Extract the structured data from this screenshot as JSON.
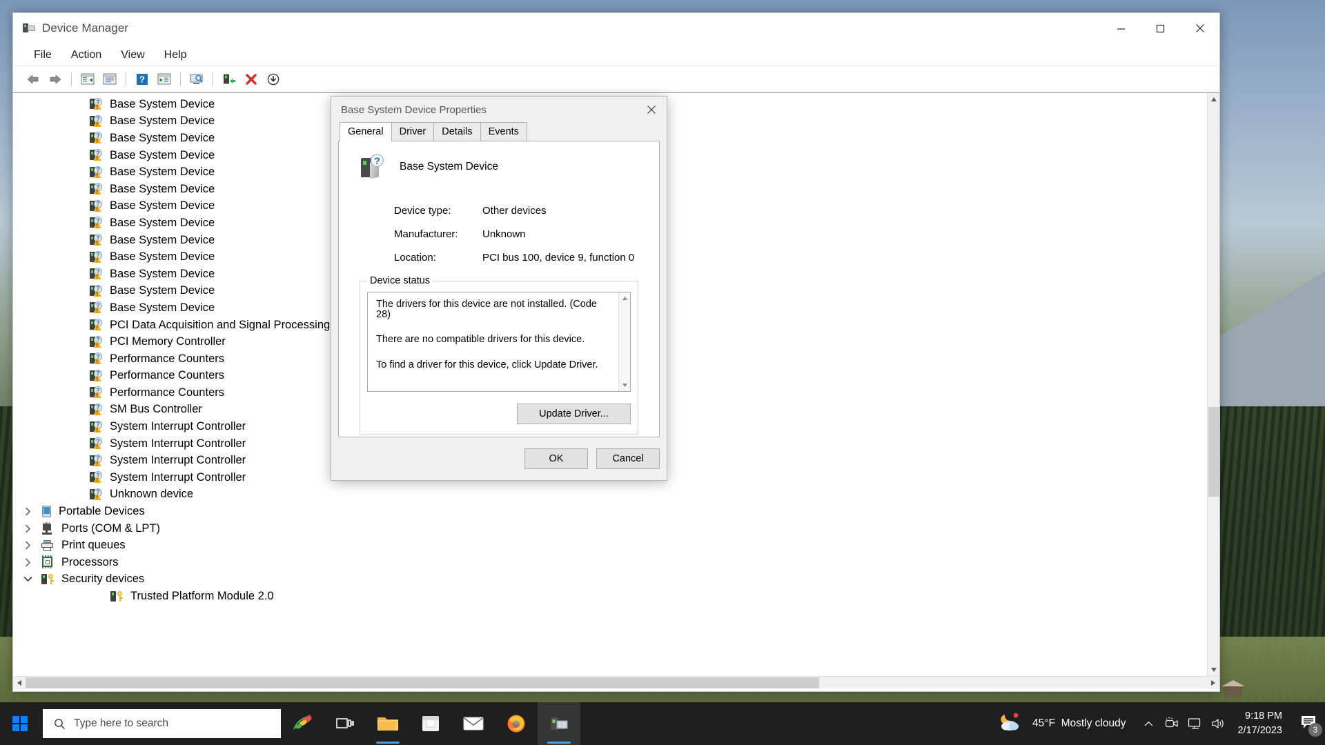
{
  "window": {
    "title": "Device Manager",
    "app_icon": "device-manager-icon",
    "caption": {
      "minimize": "minimize",
      "maximize": "maximize",
      "close": "close"
    }
  },
  "menubar": {
    "items": [
      "File",
      "Action",
      "View",
      "Help"
    ]
  },
  "toolbar": {
    "buttons": [
      "back-icon",
      "forward-icon",
      "show-hide-console-tree-icon",
      "properties-icon",
      "help-icon",
      "scan-for-hardware-changes-icon",
      "update-driver-icon",
      "uninstall-device-icon",
      "disable-device-icon",
      "enable-device-icon"
    ]
  },
  "tree": {
    "nodes": [
      {
        "label": "Base System Device",
        "icon": "unknown-device-icon",
        "level": "child",
        "twisty": ""
      },
      {
        "label": "Base System Device",
        "icon": "unknown-device-icon",
        "level": "child",
        "twisty": ""
      },
      {
        "label": "Base System Device",
        "icon": "unknown-device-icon",
        "level": "child",
        "twisty": ""
      },
      {
        "label": "Base System Device",
        "icon": "unknown-device-icon",
        "level": "child",
        "twisty": ""
      },
      {
        "label": "Base System Device",
        "icon": "unknown-device-icon",
        "level": "child",
        "twisty": ""
      },
      {
        "label": "Base System Device",
        "icon": "unknown-device-icon",
        "level": "child",
        "twisty": ""
      },
      {
        "label": "Base System Device",
        "icon": "unknown-device-icon",
        "level": "child",
        "twisty": ""
      },
      {
        "label": "Base System Device",
        "icon": "unknown-device-icon",
        "level": "child",
        "twisty": ""
      },
      {
        "label": "Base System Device",
        "icon": "unknown-device-icon",
        "level": "child",
        "twisty": ""
      },
      {
        "label": "Base System Device",
        "icon": "unknown-device-icon",
        "level": "child",
        "twisty": ""
      },
      {
        "label": "Base System Device",
        "icon": "unknown-device-icon",
        "level": "child",
        "twisty": ""
      },
      {
        "label": "Base System Device",
        "icon": "unknown-device-icon",
        "level": "child",
        "twisty": ""
      },
      {
        "label": "Base System Device",
        "icon": "unknown-device-icon",
        "level": "child",
        "twisty": ""
      },
      {
        "label": "PCI Data Acquisition and Signal Processing Controller",
        "icon": "unknown-device-icon",
        "level": "child",
        "twisty": ""
      },
      {
        "label": "PCI Memory Controller",
        "icon": "unknown-device-icon",
        "level": "child",
        "twisty": ""
      },
      {
        "label": "Performance Counters",
        "icon": "unknown-device-icon",
        "level": "child",
        "twisty": ""
      },
      {
        "label": "Performance Counters",
        "icon": "unknown-device-icon",
        "level": "child",
        "twisty": ""
      },
      {
        "label": "Performance Counters",
        "icon": "unknown-device-icon",
        "level": "child",
        "twisty": ""
      },
      {
        "label": "SM Bus Controller",
        "icon": "unknown-device-icon",
        "level": "child",
        "twisty": ""
      },
      {
        "label": "System Interrupt Controller",
        "icon": "unknown-device-icon",
        "level": "child",
        "twisty": ""
      },
      {
        "label": "System Interrupt Controller",
        "icon": "unknown-device-icon",
        "level": "child",
        "twisty": ""
      },
      {
        "label": "System Interrupt Controller",
        "icon": "unknown-device-icon",
        "level": "child",
        "twisty": ""
      },
      {
        "label": "System Interrupt Controller",
        "icon": "unknown-device-icon",
        "level": "child",
        "twisty": ""
      },
      {
        "label": "Unknown device",
        "icon": "unknown-device-icon",
        "level": "child",
        "twisty": ""
      },
      {
        "label": "Portable Devices",
        "icon": "portable-devices-icon",
        "level": "category",
        "twisty": "collapsed"
      },
      {
        "label": "Ports (COM & LPT)",
        "icon": "ports-icon",
        "level": "category",
        "twisty": "collapsed"
      },
      {
        "label": "Print queues",
        "icon": "printer-icon",
        "level": "category",
        "twisty": "collapsed"
      },
      {
        "label": "Processors",
        "icon": "processor-icon",
        "level": "category",
        "twisty": "collapsed"
      },
      {
        "label": "Security devices",
        "icon": "security-device-icon",
        "level": "category",
        "twisty": "expanded"
      },
      {
        "label": "Trusted Platform Module 2.0",
        "icon": "security-device-icon",
        "level": "grandchild",
        "twisty": ""
      }
    ]
  },
  "dialog": {
    "title": "Base System Device Properties",
    "close_label": "close",
    "tabs": [
      {
        "label": "General",
        "active": true
      },
      {
        "label": "Driver",
        "active": false
      },
      {
        "label": "Details",
        "active": false
      },
      {
        "label": "Events",
        "active": false
      }
    ],
    "device_icon_badge": "?",
    "device_name": "Base System Device",
    "properties": [
      {
        "label": "Device type:",
        "value": "Other devices"
      },
      {
        "label": "Manufacturer:",
        "value": "Unknown"
      },
      {
        "label": "Location:",
        "value": "PCI bus 100, device 9, function 0"
      }
    ],
    "status_group_label": "Device status",
    "status_lines": [
      "The drivers for this device are not installed. (Code 28)",
      "There are no compatible drivers for this device.",
      "To find a driver for this device, click Update Driver."
    ],
    "update_driver_label": "Update Driver...",
    "ok_label": "OK",
    "cancel_label": "Cancel"
  },
  "taskbar": {
    "start_label": "start-button",
    "search_placeholder": "Type here to search",
    "apps": [
      {
        "name": "task-view-icon"
      },
      {
        "name": "file-explorer-icon"
      },
      {
        "name": "microsoft-store-icon"
      },
      {
        "name": "mail-icon"
      },
      {
        "name": "firefox-icon"
      },
      {
        "name": "device-manager-taskbar-icon"
      }
    ],
    "weather": {
      "temperature": "45°F",
      "condition": "Mostly cloudy",
      "icon": "partly-cloudy-night-icon"
    },
    "tray_icons": [
      "show-hidden-icons-chevron",
      "camera-icon",
      "network-icon",
      "volume-icon"
    ],
    "clock": {
      "time": "9:18 PM",
      "date": "2/17/2023"
    },
    "notifications": {
      "count": "3",
      "icon": "notification-icon"
    }
  },
  "colors": {
    "accent": "#0a84ff",
    "warning": "#f0b323",
    "taskbar": "#1f1f1f",
    "dialog_bg": "#f0f0f0",
    "tab_active": "#ffffff"
  }
}
